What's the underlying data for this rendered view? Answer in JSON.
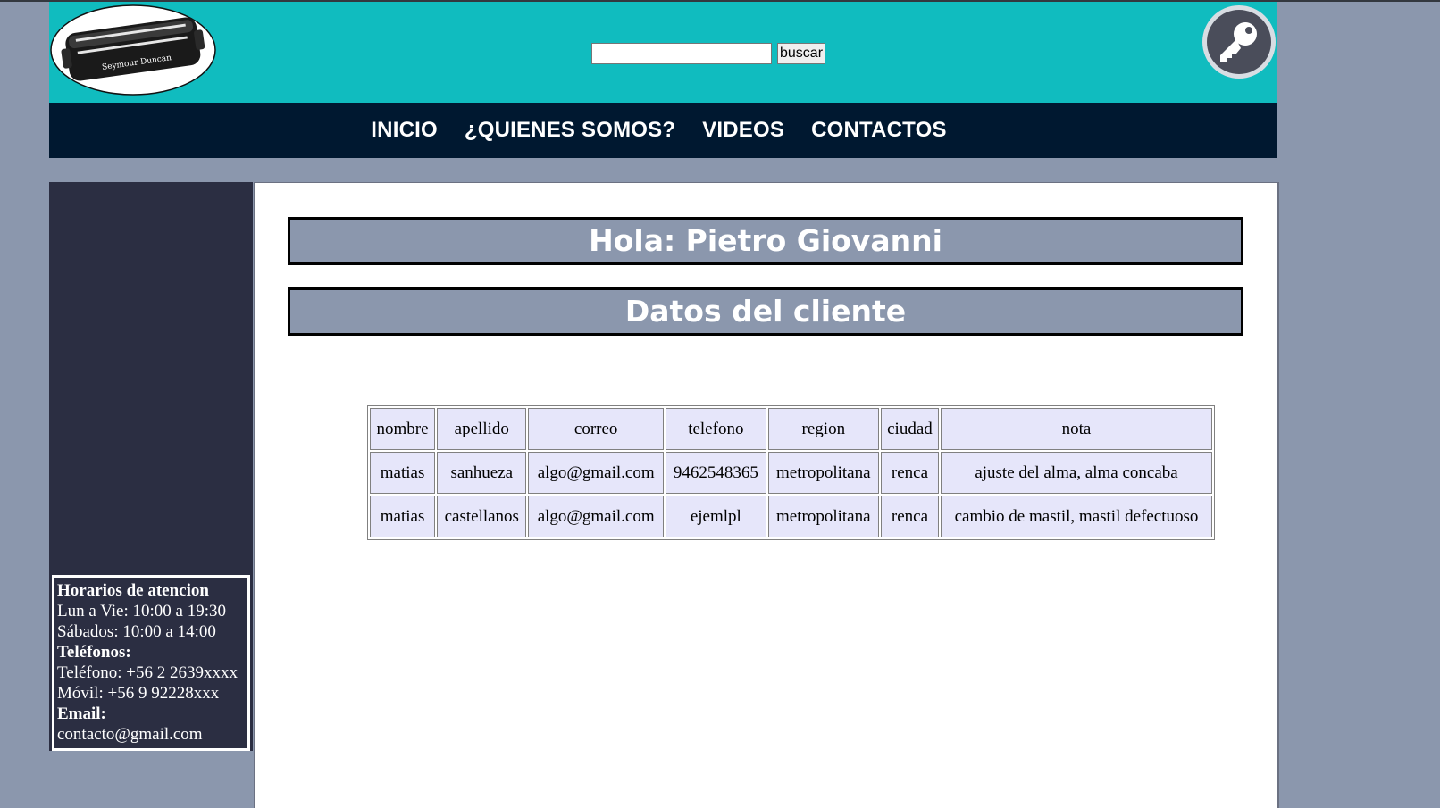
{
  "header": {
    "logo_text": "Seymour Duncan",
    "search": {
      "placeholder": "",
      "value": "",
      "button_label": "buscar"
    }
  },
  "nav": {
    "items": [
      {
        "label": "INICIO"
      },
      {
        "label": "¿QUIENES SOMOS?"
      },
      {
        "label": "VIDEOS"
      },
      {
        "label": "CONTACTOS"
      }
    ]
  },
  "sidebar": {
    "hours_title": "Horarios de atencion",
    "weekday_hours": "Lun a Vie: 10:00 a 19:30",
    "saturday_hours": "Sábados: 10:00 a 14:00",
    "phones_title": "Teléfonos:",
    "phone": "Teléfono: +56 2 2639xxxx",
    "mobile": "Móvil: +56 9 92228xxx",
    "email_title": "Email:",
    "email": "contacto@gmail.com"
  },
  "main": {
    "greeting": "Hola: Pietro Giovanni",
    "section_title": "Datos del cliente",
    "table": {
      "headers": [
        "nombre",
        "apellido",
        "correo",
        "telefono",
        "region",
        "ciudad",
        "nota"
      ],
      "rows": [
        [
          "matias",
          "sanhueza",
          "algo@gmail.com",
          "9462548365",
          "metropolitana",
          "renca",
          "ajuste del alma, alma concaba"
        ],
        [
          "matias",
          "castellanos",
          "algo@gmail.com",
          "ejemlpl",
          "metropolitana",
          "renca",
          "cambio de mastil, mastil defectuoso"
        ]
      ]
    }
  },
  "colors": {
    "header_bg": "#10bcbf",
    "nav_bg": "#001830",
    "page_bg": "#8b97ad",
    "sidebar_bg": "#2b2e42",
    "table_cell_bg": "#e6e6fa"
  }
}
